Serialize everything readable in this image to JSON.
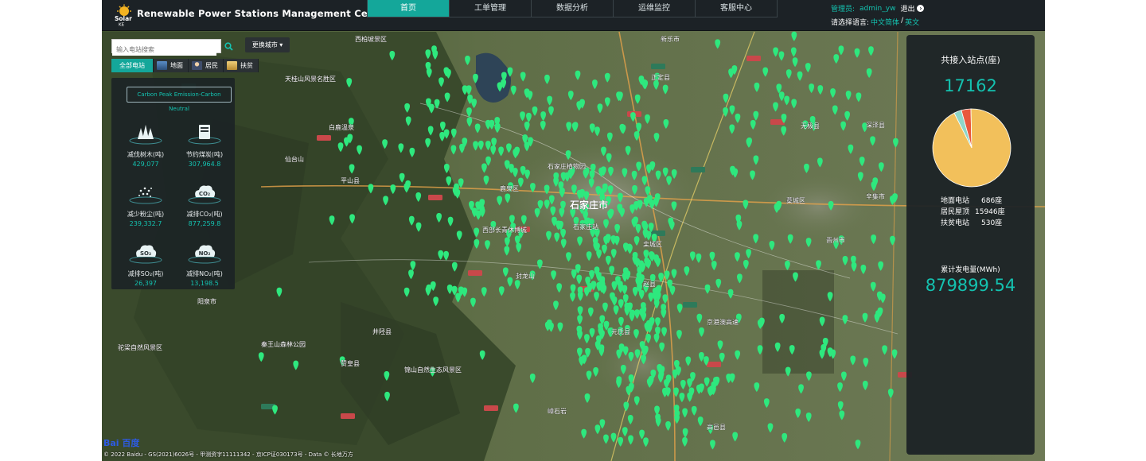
{
  "header": {
    "app_title": "Renewable Power Stations Management Center",
    "logo_text": "Solar KE",
    "nav": [
      {
        "label": "首页",
        "active": true
      },
      {
        "label": "工单管理",
        "active": false
      },
      {
        "label": "数据分析",
        "active": false
      },
      {
        "label": "运维监控",
        "active": false
      },
      {
        "label": "客服中心",
        "active": false
      }
    ],
    "user_label": "管理员:",
    "user_name": "admin_yw",
    "logout_label": "退出",
    "lang_prompt": "请选择语言:",
    "lang_options": [
      "中文简体",
      "英文"
    ],
    "lang_sep": "/"
  },
  "search": {
    "placeholder": "输入电站搜索",
    "city_button": "更换城市 ▾"
  },
  "filters": [
    {
      "label": "全部电站",
      "active": true,
      "icon": "all-icon"
    },
    {
      "label": "地面",
      "active": false,
      "icon": "ground-icon",
      "color": "#3c6fa8"
    },
    {
      "label": "居民",
      "active": false,
      "icon": "resident-icon",
      "color": "#5a6b8c"
    },
    {
      "label": "扶贫",
      "active": false,
      "icon": "poverty-icon",
      "color": "#c9a24a"
    }
  ],
  "left_panel": {
    "title": "Carbon Peak Emission-Carbon Neutral",
    "stats": [
      {
        "label": "减伐树木(吨)",
        "value": "429,077",
        "icon": "trees-icon"
      },
      {
        "label": "节约煤炭(吨)",
        "value": "307,964.8",
        "icon": "coal-icon"
      },
      {
        "label": "减少粉尘(吨)",
        "value": "239,332.7",
        "icon": "dust-icon"
      },
      {
        "label": "减排CO₂(吨)",
        "value": "877,259.8",
        "icon": "co2-icon",
        "badge": "CO₂"
      },
      {
        "label": "减排SO₂(吨)",
        "value": "26,397",
        "icon": "so2-icon",
        "badge": "SO₂"
      },
      {
        "label": "减排NO₂(吨)",
        "value": "13,198.5",
        "icon": "no2-icon",
        "badge": "NO₂"
      }
    ]
  },
  "right_panel": {
    "total_title": "共接入站点(座)",
    "total_count": "17162",
    "pie": [
      {
        "name": "地面电站",
        "value": 686,
        "color": "#e8573c"
      },
      {
        "name": "居民屋顶",
        "value": 15946,
        "color": "#f2c05b"
      },
      {
        "name": "扶贫电站",
        "value": 530,
        "color": "#8ed6c8"
      }
    ],
    "legend": [
      {
        "name": "地面电站",
        "count": "686座"
      },
      {
        "name": "居民屋顶",
        "count": "15946座"
      },
      {
        "name": "扶贫电站",
        "count": "530座"
      }
    ],
    "gen_title": "累计发电量(MWh)",
    "gen_value": "879899.54"
  },
  "map": {
    "logo": "Bai 百度",
    "copyright": "© 2022 Baidu - GS(2021)6026号 - 甲测资字11111342 - 京ICP证030173号 - Data © 长地万方",
    "marker_color": "#2ee87e",
    "labels": [
      {
        "text": "石家庄市"
      },
      {
        "text": "西柏坡景区"
      },
      {
        "text": "新乐市"
      },
      {
        "text": "无极县"
      },
      {
        "text": "深泽县"
      },
      {
        "text": "平山县"
      },
      {
        "text": "鹿泉区"
      },
      {
        "text": "藁城区"
      },
      {
        "text": "晋州市"
      },
      {
        "text": "辛集市"
      },
      {
        "text": "赵县"
      },
      {
        "text": "栾城区"
      },
      {
        "text": "元氏县"
      },
      {
        "text": "高邑县"
      },
      {
        "text": "井陉县"
      },
      {
        "text": "赞皇县"
      },
      {
        "text": "阳泉市"
      },
      {
        "text": "秦王山森林公园"
      },
      {
        "text": "驼梁自然风景区"
      },
      {
        "text": "锦山自然生态风景区"
      },
      {
        "text": "嶂石岩"
      },
      {
        "text": "西部长青休博城"
      },
      {
        "text": "封龙山"
      },
      {
        "text": "石家庄站"
      },
      {
        "text": "白鹿温泉"
      },
      {
        "text": "仙台山"
      },
      {
        "text": "天桂山风景名胜区"
      },
      {
        "text": "石家庄植物园"
      },
      {
        "text": "正定县"
      },
      {
        "text": "京港澳高速"
      }
    ]
  }
}
